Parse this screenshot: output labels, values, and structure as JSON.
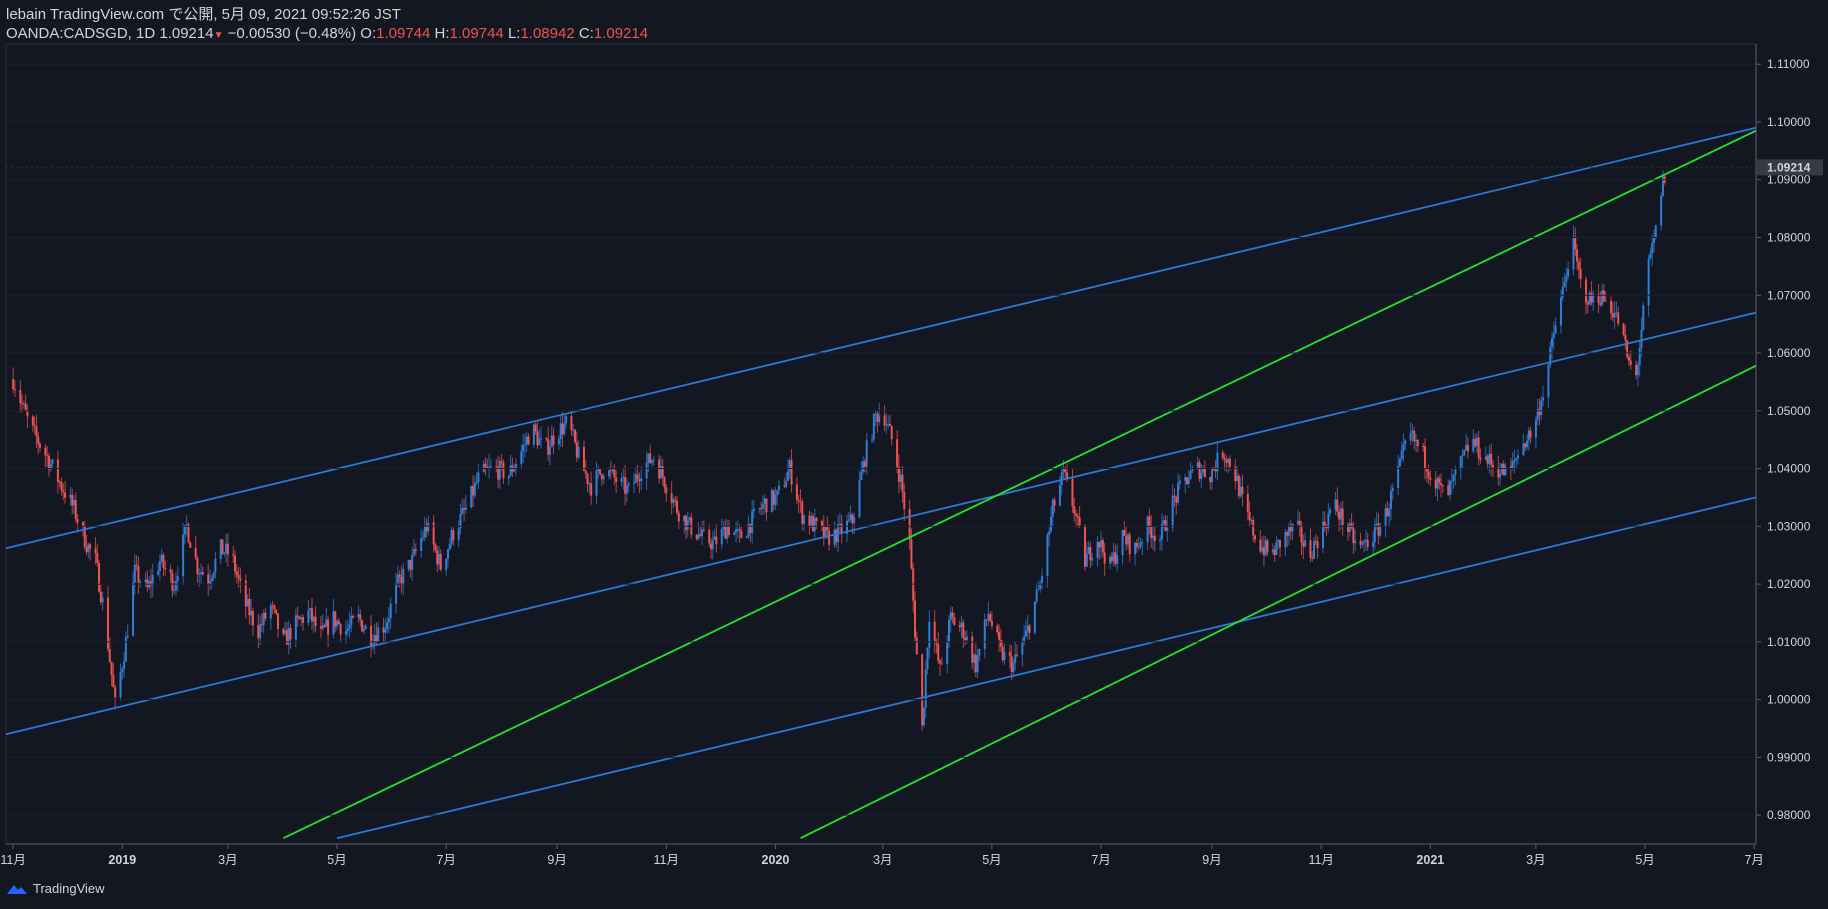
{
  "header": {
    "publish_line": "lebain TradingView.com で公開, 5月 09, 2021 09:52:26 JST",
    "symbol_line": "OANDA:CADSGD, 1D 1.09214",
    "change": "−0.00530 (−0.48%)",
    "open_label": "O:",
    "open_value": "1.09744",
    "high_label": "H:",
    "high_value": "1.09744",
    "low_label": "L:",
    "low_value": "1.08942",
    "close_label": "C:",
    "close_value": "1.09214"
  },
  "footer": {
    "brand": "TradingView"
  },
  "colors": {
    "background": "#131722",
    "up": "#2f7fd8",
    "down": "#ef5350",
    "channel": "#2979d6",
    "trend": "#1ee52b",
    "text": "#d1d4dc"
  },
  "chart_data": {
    "type": "candlestick",
    "symbol": "OANDA:CADSGD",
    "interval": "1D",
    "last_price": 1.09214,
    "last_price_label": "1.09214",
    "ylim": [
      0.975,
      1.1135
    ],
    "xlim": [
      "2018-10-28",
      "2021-07-02"
    ],
    "y_ticks": [
      "1.11000",
      "1.10000",
      "1.09000",
      "1.08000",
      "1.07000",
      "1.06000",
      "1.05000",
      "1.04000",
      "1.03000",
      "1.02000",
      "1.01000",
      "1.00000",
      "0.99000",
      "0.98000"
    ],
    "x_ticks": [
      {
        "label": "11月",
        "date": "2018-11-01"
      },
      {
        "label": "2019",
        "date": "2019-01-01"
      },
      {
        "label": "3月",
        "date": "2019-03-01"
      },
      {
        "label": "5月",
        "date": "2019-05-01"
      },
      {
        "label": "7月",
        "date": "2019-07-01"
      },
      {
        "label": "9月",
        "date": "2019-09-01"
      },
      {
        "label": "11月",
        "date": "2019-11-01"
      },
      {
        "label": "2020",
        "date": "2020-01-01"
      },
      {
        "label": "3月",
        "date": "2020-03-01"
      },
      {
        "label": "5月",
        "date": "2020-05-01"
      },
      {
        "label": "7月",
        "date": "2020-07-01"
      },
      {
        "label": "9月",
        "date": "2020-09-01"
      },
      {
        "label": "11月",
        "date": "2020-11-01"
      },
      {
        "label": "2021",
        "date": "2021-01-01"
      },
      {
        "label": "3月",
        "date": "2021-03-01"
      },
      {
        "label": "5月",
        "date": "2021-05-01"
      },
      {
        "label": "7月",
        "date": "2021-07-01"
      }
    ],
    "close_path": [
      [
        "2018-11-01",
        1.0555
      ],
      [
        "2018-11-10",
        1.0475
      ],
      [
        "2018-11-20",
        1.042
      ],
      [
        "2018-11-28",
        1.037
      ],
      [
        "2018-12-05",
        1.033
      ],
      [
        "2018-12-12",
        1.027
      ],
      [
        "2018-12-17",
        1.024
      ],
      [
        "2018-12-22",
        1.015
      ],
      [
        "2018-12-28",
        0.999
      ],
      [
        "2019-01-03",
        1.01
      ],
      [
        "2019-01-08",
        1.022
      ],
      [
        "2019-01-15",
        1.019
      ],
      [
        "2019-01-22",
        1.024
      ],
      [
        "2019-01-30",
        1.02
      ],
      [
        "2019-02-06",
        1.03
      ],
      [
        "2019-02-12",
        1.023
      ],
      [
        "2019-02-18",
        1.021
      ],
      [
        "2019-02-25",
        1.026
      ],
      [
        "2019-03-03",
        1.025
      ],
      [
        "2019-03-10",
        1.017
      ],
      [
        "2019-03-18",
        1.012
      ],
      [
        "2019-03-25",
        1.016
      ],
      [
        "2019-04-01",
        1.01
      ],
      [
        "2019-04-08",
        1.013
      ],
      [
        "2019-04-15",
        1.015
      ],
      [
        "2019-04-22",
        1.011
      ],
      [
        "2019-04-29",
        1.014
      ],
      [
        "2019-05-06",
        1.012
      ],
      [
        "2019-05-13",
        1.014
      ],
      [
        "2019-05-20",
        1.011
      ],
      [
        "2019-05-28",
        1.013
      ],
      [
        "2019-06-04",
        1.02
      ],
      [
        "2019-06-12",
        1.024
      ],
      [
        "2019-06-20",
        1.03
      ],
      [
        "2019-06-28",
        1.023
      ],
      [
        "2019-07-05",
        1.029
      ],
      [
        "2019-07-12",
        1.033
      ],
      [
        "2019-07-20",
        1.039
      ],
      [
        "2019-07-28",
        1.04
      ],
      [
        "2019-08-05",
        1.039
      ],
      [
        "2019-08-12",
        1.043
      ],
      [
        "2019-08-18",
        1.047
      ],
      [
        "2019-08-25",
        1.043
      ],
      [
        "2019-08-31",
        1.046
      ],
      [
        "2019-09-07",
        1.048
      ],
      [
        "2019-09-14",
        1.041
      ],
      [
        "2019-09-20",
        1.037
      ],
      [
        "2019-09-27",
        1.04
      ],
      [
        "2019-10-04",
        1.038
      ],
      [
        "2019-10-11",
        1.036
      ],
      [
        "2019-10-18",
        1.04
      ],
      [
        "2019-10-25",
        1.042
      ],
      [
        "2019-10-31",
        1.038
      ],
      [
        "2019-11-07",
        1.033
      ],
      [
        "2019-11-14",
        1.03
      ],
      [
        "2019-11-21",
        1.028
      ],
      [
        "2019-11-28",
        1.027
      ],
      [
        "2019-12-05",
        1.03
      ],
      [
        "2019-12-12",
        1.028
      ],
      [
        "2019-12-19",
        1.031
      ],
      [
        "2019-12-26",
        1.034
      ],
      [
        "2020-01-02",
        1.035
      ],
      [
        "2020-01-09",
        1.04
      ],
      [
        "2020-01-16",
        1.032
      ],
      [
        "2020-01-23",
        1.03
      ],
      [
        "2020-01-30",
        1.028
      ],
      [
        "2020-02-06",
        1.029
      ],
      [
        "2020-02-13",
        1.031
      ],
      [
        "2020-02-20",
        1.042
      ],
      [
        "2020-02-26",
        1.049
      ],
      [
        "2020-03-01",
        1.05
      ],
      [
        "2020-03-06",
        1.045
      ],
      [
        "2020-03-11",
        1.038
      ],
      [
        "2020-03-16",
        1.027
      ],
      [
        "2020-03-19",
        1.012
      ],
      [
        "2020-03-23",
        0.995
      ],
      [
        "2020-03-27",
        1.015
      ],
      [
        "2020-04-02",
        1.005
      ],
      [
        "2020-04-08",
        1.014
      ],
      [
        "2020-04-15",
        1.012
      ],
      [
        "2020-04-22",
        1.006
      ],
      [
        "2020-04-29",
        1.015
      ],
      [
        "2020-05-06",
        1.008
      ],
      [
        "2020-05-13",
        1.006
      ],
      [
        "2020-05-20",
        1.011
      ],
      [
        "2020-05-28",
        1.02
      ],
      [
        "2020-06-04",
        1.033
      ],
      [
        "2020-06-10",
        1.039
      ],
      [
        "2020-06-16",
        1.033
      ],
      [
        "2020-06-22",
        1.024
      ],
      [
        "2020-06-29",
        1.028
      ],
      [
        "2020-07-06",
        1.023
      ],
      [
        "2020-07-13",
        1.028
      ],
      [
        "2020-07-20",
        1.026
      ],
      [
        "2020-07-27",
        1.03
      ],
      [
        "2020-08-03",
        1.028
      ],
      [
        "2020-08-10",
        1.034
      ],
      [
        "2020-08-17",
        1.038
      ],
      [
        "2020-08-24",
        1.04
      ],
      [
        "2020-08-31",
        1.039
      ],
      [
        "2020-09-07",
        1.043
      ],
      [
        "2020-09-13",
        1.04
      ],
      [
        "2020-09-20",
        1.032
      ],
      [
        "2020-09-27",
        1.027
      ],
      [
        "2020-10-04",
        1.025
      ],
      [
        "2020-10-11",
        1.028
      ],
      [
        "2020-10-18",
        1.03
      ],
      [
        "2020-10-25",
        1.025
      ],
      [
        "2020-11-01",
        1.029
      ],
      [
        "2020-11-08",
        1.034
      ],
      [
        "2020-11-15",
        1.03
      ],
      [
        "2020-11-22",
        1.026
      ],
      [
        "2020-11-29",
        1.028
      ],
      [
        "2020-12-06",
        1.031
      ],
      [
        "2020-12-13",
        1.038
      ],
      [
        "2020-12-20",
        1.046
      ],
      [
        "2020-12-27",
        1.043
      ],
      [
        "2021-01-03",
        1.038
      ],
      [
        "2021-01-10",
        1.035
      ],
      [
        "2021-01-17",
        1.04
      ],
      [
        "2021-01-24",
        1.045
      ],
      [
        "2021-01-31",
        1.042
      ],
      [
        "2021-02-07",
        1.04
      ],
      [
        "2021-02-14",
        1.039
      ],
      [
        "2021-02-21",
        1.044
      ],
      [
        "2021-02-28",
        1.047
      ],
      [
        "2021-03-07",
        1.056
      ],
      [
        "2021-03-12",
        1.065
      ],
      [
        "2021-03-17",
        1.072
      ],
      [
        "2021-03-21",
        1.08
      ],
      [
        "2021-03-26",
        1.072
      ],
      [
        "2021-03-31",
        1.069
      ],
      [
        "2021-04-06",
        1.07
      ],
      [
        "2021-04-12",
        1.068
      ],
      [
        "2021-04-17",
        1.065
      ],
      [
        "2021-04-22",
        1.058
      ],
      [
        "2021-04-26",
        1.056
      ],
      [
        "2021-04-29",
        1.064
      ],
      [
        "2021-05-03",
        1.075
      ],
      [
        "2021-05-07",
        1.081
      ],
      [
        "2021-05-10",
        1.088
      ],
      [
        "2021-05-13",
        1.0921
      ]
    ],
    "series": [
      {
        "name": "upper-channel-line",
        "type": "trendline",
        "points": [
          [
            "2018-10-28",
            1.0262
          ],
          [
            "2021-07-02",
            1.099
          ]
        ]
      },
      {
        "name": "middle-channel-line",
        "type": "trendline",
        "points": [
          [
            "2018-10-28",
            0.994
          ],
          [
            "2021-07-02",
            1.067
          ]
        ]
      },
      {
        "name": "lower-channel-line",
        "type": "trendline",
        "points": [
          [
            "2019-05-01",
            0.976
          ],
          [
            "2021-07-02",
            1.035
          ]
        ]
      },
      {
        "name": "upper-green-trendline",
        "type": "trendline",
        "points": [
          [
            "2019-04-01",
            0.976
          ],
          [
            "2021-07-02",
            1.0985
          ]
        ]
      },
      {
        "name": "lower-green-trendline",
        "type": "trendline",
        "points": [
          [
            "2020-01-15",
            0.976
          ],
          [
            "2021-07-02",
            1.0578
          ]
        ]
      }
    ]
  }
}
